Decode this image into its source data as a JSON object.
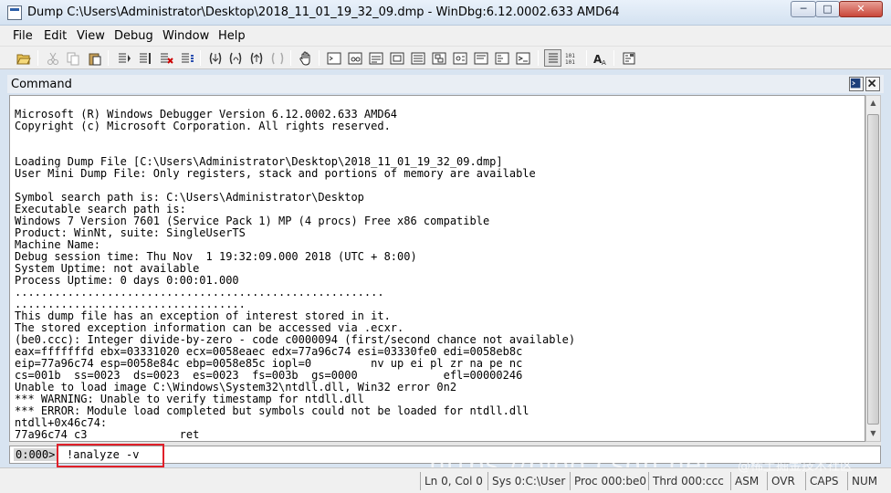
{
  "window": {
    "title": "Dump C:\\Users\\Administrator\\Desktop\\2018_11_01_19_32_09.dmp - WinDbg:6.12.0002.633 AMD64",
    "controls": {
      "minimize": "─",
      "maximize": "□",
      "close": "✕"
    }
  },
  "menu": {
    "items": [
      "File",
      "Edit",
      "View",
      "Debug",
      "Window",
      "Help"
    ]
  },
  "toolbar": {
    "icons": [
      "open-icon",
      "cut-icon",
      "copy-icon",
      "paste-icon",
      "go-icon",
      "restart-icon",
      "stop-debugging-icon",
      "break-icon",
      "step-into-icon",
      "step-over-icon",
      "step-out-icon",
      "run-to-cursor-icon",
      "hand-icon",
      "command-icon",
      "watch-icon",
      "locals-icon",
      "registers-icon",
      "memory-icon",
      "call-stack-icon",
      "disassembly-icon",
      "scratch-pad-icon",
      "source-mode-icon",
      "hex-icon",
      "font-icon",
      "options-icon"
    ]
  },
  "command_window": {
    "title": "Command",
    "output": "Microsoft (R) Windows Debugger Version 6.12.0002.633 AMD64\nCopyright (c) Microsoft Corporation. All rights reserved.\n\n\nLoading Dump File [C:\\Users\\Administrator\\Desktop\\2018_11_01_19_32_09.dmp]\nUser Mini Dump File: Only registers, stack and portions of memory are available\n\nSymbol search path is: C:\\Users\\Administrator\\Desktop\nExecutable search path is:\nWindows 7 Version 7601 (Service Pack 1) MP (4 procs) Free x86 compatible\nProduct: WinNt, suite: SingleUserTS\nMachine Name:\nDebug session time: Thu Nov  1 19:32:09.000 2018 (UTC + 8:00)\nSystem Uptime: not available\nProcess Uptime: 0 days 0:00:01.000\n........................................................\n...................................\nThis dump file has an exception of interest stored in it.\nThe stored exception information can be accessed via .ecxr.\n(be0.ccc): Integer divide-by-zero - code c0000094 (first/second chance not available)\neax=fffffffd ebx=03331020 ecx=0058eaec edx=77a96c74 esi=03330fe0 edi=0058eb8c\neip=77a96c74 esp=0058e84c ebp=0058e85c iopl=0         nv up ei pl zr na pe nc\ncs=001b  ss=0023  ds=0023  es=0023  fs=003b  gs=0000             efl=00000246\nUnable to load image C:\\Windows\\System32\\ntdll.dll, Win32 error 0n2\n*** WARNING: Unable to verify timestamp for ntdll.dll\n*** ERROR: Module load completed but symbols could not be loaded for ntdll.dll\nntdll+0x46c74:\n77a96c74 c3              ret",
    "prompt": "0:000>",
    "input_value": "!analyze -v"
  },
  "statusbar": {
    "cells": [
      "Ln 0, Col 0",
      "Sys 0:C:\\User",
      "Proc 000:be0",
      "Thrd 000:ccc",
      "ASM",
      "OVR",
      "CAPS",
      "NUM"
    ]
  },
  "watermark": {
    "text": "https://blog.csdn.net",
    "text2": "@稀土掘金技术社区"
  },
  "colors": {
    "highlight": "#e0202a",
    "title_bg": "#dce7f3"
  }
}
